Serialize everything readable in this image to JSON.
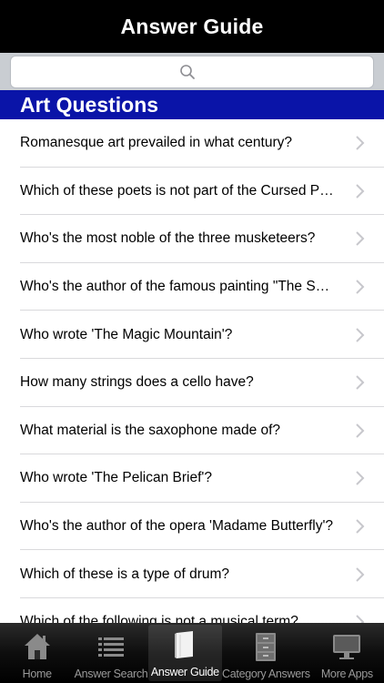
{
  "header": {
    "title": "Answer Guide"
  },
  "search": {
    "value": "",
    "placeholder": ""
  },
  "section": {
    "title": "Art Questions"
  },
  "questions": [
    "Romanesque art prevailed in what century?",
    "Which of these poets is not part of the Cursed P…",
    "Who's the most noble of the three musketeers?",
    "Who's the author of the famous painting \"The S…",
    "Who wrote 'The Magic Mountain'?",
    "How many strings does a cello have?",
    "What material is the saxophone made of?",
    "Who wrote 'The Pelican Brief'?",
    "Who's the author of the opera 'Madame Butterfly'?",
    "Which of these is a type of drum?",
    "Which of the following is not a musical term?"
  ],
  "tabs": [
    {
      "label": "Home",
      "icon": "home-icon",
      "active": false
    },
    {
      "label": "Answer Search",
      "icon": "list-icon",
      "active": false
    },
    {
      "label": "Answer Guide",
      "icon": "book-icon",
      "active": true
    },
    {
      "label": "Category Answers",
      "icon": "cabinet-icon",
      "active": false
    },
    {
      "label": "More Apps",
      "icon": "monitor-icon",
      "active": false
    }
  ],
  "colors": {
    "navbar": "#000000",
    "section_header": "#0a14a8",
    "tab_inactive": "#9a9a9a",
    "tab_active": "#ffffff"
  }
}
